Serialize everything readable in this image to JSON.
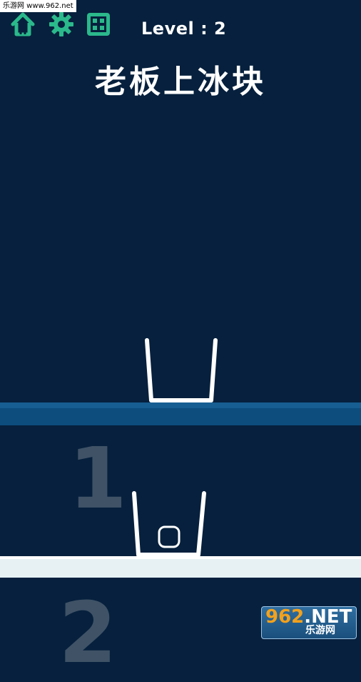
{
  "watermark_top": "乐游网 www.962.net",
  "level_label": "Level : 2",
  "title": "老板上冰块",
  "icons": {
    "home": "home-icon",
    "settings": "gear-icon",
    "levels": "grid-icon"
  },
  "colors": {
    "background": "#06203d",
    "accent_green": "#2bb98b",
    "platform_blue": "#0d4d7e",
    "platform_white": "#e7f1f4",
    "hint_number": "#3f5266"
  },
  "hints": [
    "1",
    "2"
  ],
  "watermark_bottom": {
    "logo_num": "962",
    "logo_net": ".NET",
    "sub": "乐游网"
  }
}
